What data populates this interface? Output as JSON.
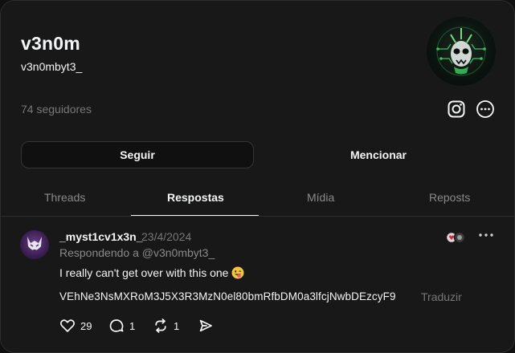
{
  "profile": {
    "display_name": "v3n0m",
    "username": "v3n0mbyt3_",
    "followers": "74 seguidores"
  },
  "actions": {
    "follow_label": "Seguir",
    "mention_label": "Mencionar"
  },
  "tabs": [
    {
      "label": "Threads",
      "active": false
    },
    {
      "label": "Respostas",
      "active": true
    },
    {
      "label": "Mídia",
      "active": false
    },
    {
      "label": "Reposts",
      "active": false
    }
  ],
  "post": {
    "author": "_myst1cv1x3n_",
    "date": "23/4/2024",
    "reply_prefix": "Respondendo a ",
    "reply_to": "@v3n0mbyt3_",
    "text": "I really can't get over with this one",
    "code": "VEhNe3NsMXRoM3J5X3R3MzN0el80bmRfbDM0a3lfcjNwbDEzcyF9",
    "translate_label": "Traduzir",
    "likes": "29",
    "comments": "1",
    "reposts": "1"
  },
  "colors": {
    "background": "#181818",
    "text": "#f3f5f7",
    "muted": "#777777",
    "border": "#2d2d2d"
  },
  "icons": [
    "instagram-icon",
    "more-circle-icon",
    "more-horizontal-icon",
    "heart-icon",
    "comment-icon",
    "repost-icon",
    "share-icon",
    "emoji-icon"
  ]
}
